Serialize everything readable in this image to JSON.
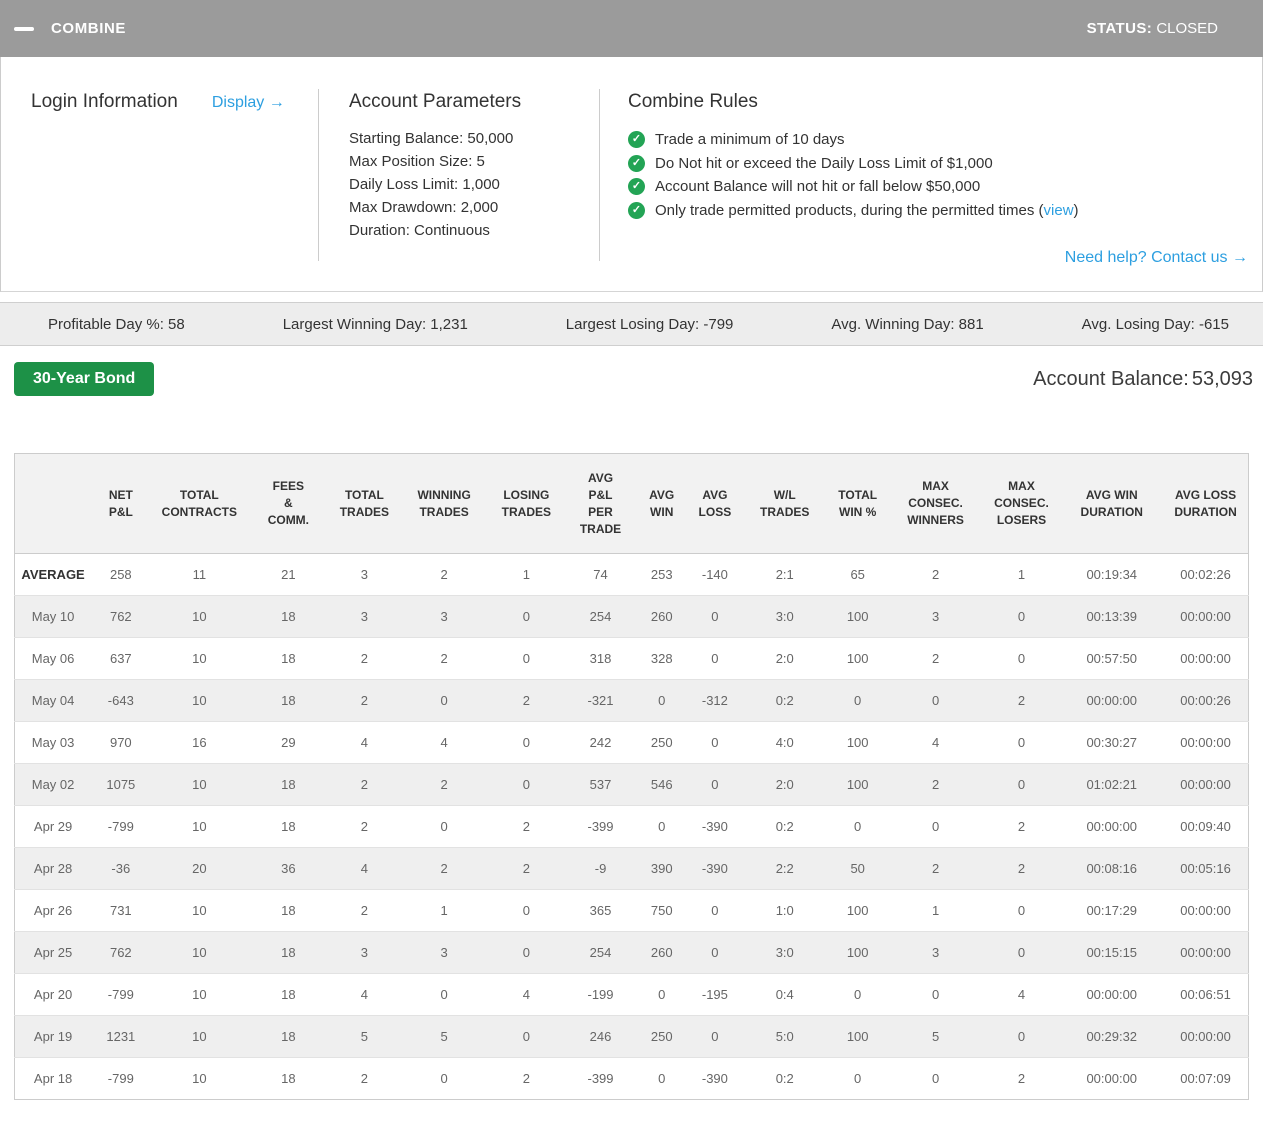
{
  "header": {
    "title": "COMBINE",
    "status_label": "STATUS:",
    "status_value": "CLOSED"
  },
  "panels": {
    "login": {
      "title": "Login Information",
      "display_link": "Display →"
    },
    "account_parameters": {
      "title": "Account Parameters",
      "items": [
        "Starting Balance: 50,000",
        "Max Position Size: 5",
        "Daily Loss Limit: 1,000",
        "Max Drawdown: 2,000",
        "Duration: Continuous"
      ]
    },
    "combine_rules": {
      "title": "Combine Rules",
      "rules": [
        {
          "text": "Trade a minimum of 10 days"
        },
        {
          "text": "Do Not hit or exceed the Daily Loss Limit of $1,000"
        },
        {
          "text": "Account Balance will not hit or fall below $50,000"
        },
        {
          "text": "Only trade permitted products, during the permitted times (",
          "link": "view",
          "suffix": ")"
        }
      ],
      "help_link": "Need help? Contact us →"
    }
  },
  "stats_bar": {
    "items": [
      {
        "label": "Profitable Day %",
        "value": "58"
      },
      {
        "label": "Largest Winning Day",
        "value": "1,231"
      },
      {
        "label": "Largest Losing Day",
        "value": "-799"
      },
      {
        "label": "Avg. Winning Day",
        "value": "881"
      },
      {
        "label": "Avg. Losing Day",
        "value": "-615"
      }
    ]
  },
  "account": {
    "product_label": "30-Year Bond",
    "balance_label": "Account Balance:",
    "balance_value": "53,093"
  },
  "table": {
    "columns": [
      "",
      "NET\nP&L",
      "TOTAL\nCONTRACTS",
      "FEES\n&\nCOMM.",
      "TOTAL\nTRADES",
      "WINNING\nTRADES",
      "LOSING\nTRADES",
      "AVG\nP&L\nPER\nTRADE",
      "AVG\nWIN",
      "AVG\nLOSS",
      "W/L\nTRADES",
      "TOTAL\nWIN %",
      "MAX\nCONSEC.\nWINNERS",
      "MAX\nCONSEC.\nLOSERS",
      "AVG WIN\nDURATION",
      "AVG LOSS\nDURATION"
    ],
    "rows": [
      {
        "label": "AVERAGE",
        "is_summary": true,
        "cells": [
          "258",
          "11",
          "21",
          "3",
          "2",
          "1",
          "74",
          "253",
          "-140",
          "2:1",
          "65",
          "2",
          "1",
          "00:19:34",
          "00:02:26"
        ]
      },
      {
        "label": "May 10",
        "cells": [
          "762",
          "10",
          "18",
          "3",
          "3",
          "0",
          "254",
          "260",
          "0",
          "3:0",
          "100",
          "3",
          "0",
          "00:13:39",
          "00:00:00"
        ]
      },
      {
        "label": "May 06",
        "cells": [
          "637",
          "10",
          "18",
          "2",
          "2",
          "0",
          "318",
          "328",
          "0",
          "2:0",
          "100",
          "2",
          "0",
          "00:57:50",
          "00:00:00"
        ]
      },
      {
        "label": "May 04",
        "cells": [
          "-643",
          "10",
          "18",
          "2",
          "0",
          "2",
          "-321",
          "0",
          "-312",
          "0:2",
          "0",
          "0",
          "2",
          "00:00:00",
          "00:00:26"
        ]
      },
      {
        "label": "May 03",
        "cells": [
          "970",
          "16",
          "29",
          "4",
          "4",
          "0",
          "242",
          "250",
          "0",
          "4:0",
          "100",
          "4",
          "0",
          "00:30:27",
          "00:00:00"
        ]
      },
      {
        "label": "May 02",
        "cells": [
          "1075",
          "10",
          "18",
          "2",
          "2",
          "0",
          "537",
          "546",
          "0",
          "2:0",
          "100",
          "2",
          "0",
          "01:02:21",
          "00:00:00"
        ]
      },
      {
        "label": "Apr 29",
        "cells": [
          "-799",
          "10",
          "18",
          "2",
          "0",
          "2",
          "-399",
          "0",
          "-390",
          "0:2",
          "0",
          "0",
          "2",
          "00:00:00",
          "00:09:40"
        ]
      },
      {
        "label": "Apr 28",
        "cells": [
          "-36",
          "20",
          "36",
          "4",
          "2",
          "2",
          "-9",
          "390",
          "-390",
          "2:2",
          "50",
          "2",
          "2",
          "00:08:16",
          "00:05:16"
        ]
      },
      {
        "label": "Apr 26",
        "cells": [
          "731",
          "10",
          "18",
          "2",
          "1",
          "0",
          "365",
          "750",
          "0",
          "1:0",
          "100",
          "1",
          "0",
          "00:17:29",
          "00:00:00"
        ]
      },
      {
        "label": "Apr 25",
        "cells": [
          "762",
          "10",
          "18",
          "3",
          "3",
          "0",
          "254",
          "260",
          "0",
          "3:0",
          "100",
          "3",
          "0",
          "00:15:15",
          "00:00:00"
        ]
      },
      {
        "label": "Apr 20",
        "cells": [
          "-799",
          "10",
          "18",
          "4",
          "0",
          "4",
          "-199",
          "0",
          "-195",
          "0:4",
          "0",
          "0",
          "4",
          "00:00:00",
          "00:06:51"
        ]
      },
      {
        "label": "Apr 19",
        "cells": [
          "1231",
          "10",
          "18",
          "5",
          "5",
          "0",
          "246",
          "250",
          "0",
          "5:0",
          "100",
          "5",
          "0",
          "00:29:32",
          "00:00:00"
        ]
      },
      {
        "label": "Apr 18",
        "cells": [
          "-799",
          "10",
          "18",
          "2",
          "0",
          "2",
          "-399",
          "0",
          "-390",
          "0:2",
          "0",
          "0",
          "2",
          "00:00:00",
          "00:07:09"
        ]
      }
    ]
  },
  "colors": {
    "header_gray": "#9b9b9b",
    "link_blue": "#2d9fe0",
    "check_green": "#23a455",
    "button_green": "#1d9147",
    "zebra_gray": "#efefef"
  }
}
